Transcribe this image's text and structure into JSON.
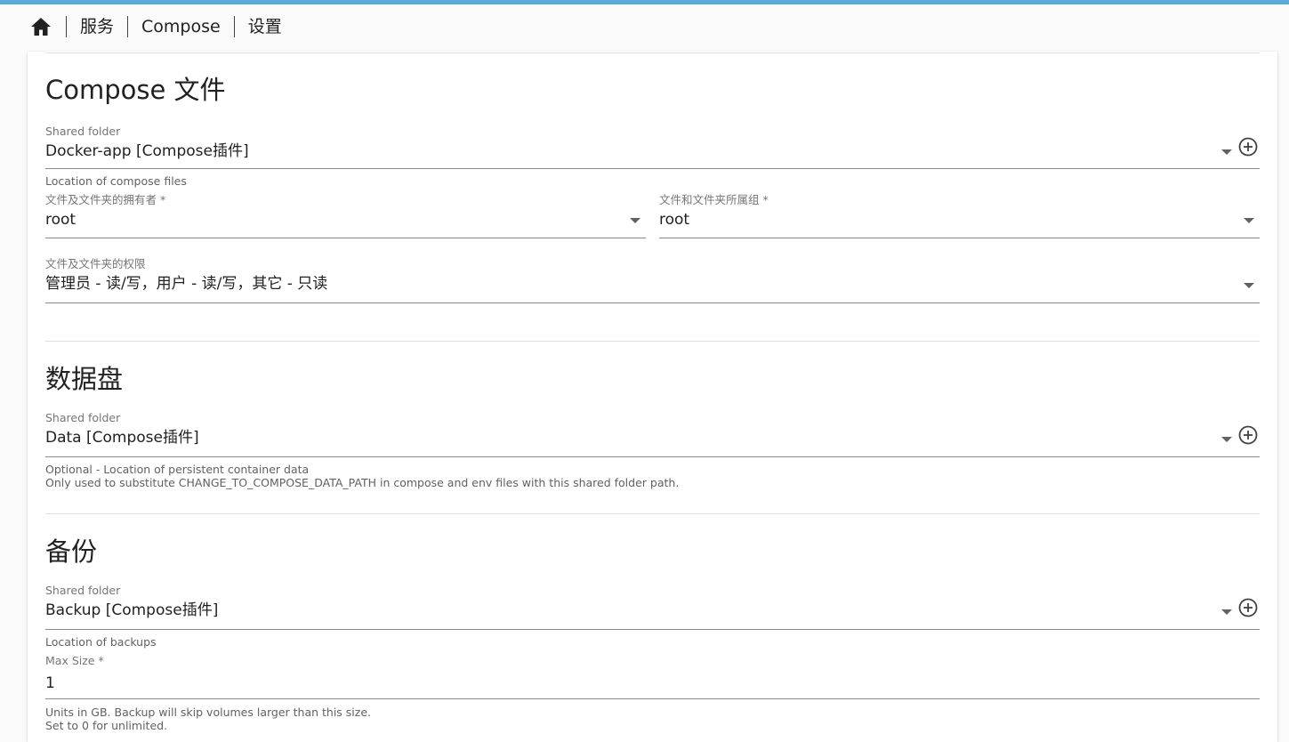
{
  "breadcrumb": {
    "items": [
      "服务",
      "Compose",
      "设置"
    ]
  },
  "sections": {
    "compose": {
      "title": "Compose 文件",
      "shared_folder": {
        "label": "Shared folder",
        "value": "Docker-app [Compose插件]",
        "hint": "Location of compose files"
      },
      "owner": {
        "label": "文件及文件夹的拥有者 *",
        "value": "root"
      },
      "group": {
        "label": "文件和文件夹所属组 *",
        "value": "root"
      },
      "permissions": {
        "label": "文件及文件夹的权限",
        "value": "管理员 - 读/写，用户 - 读/写，其它 - 只读"
      }
    },
    "data": {
      "title": "数据盘",
      "shared_folder": {
        "label": "Shared folder",
        "value": "Data [Compose插件]",
        "hint_line1": "Optional - Location of persistent container data",
        "hint_line2": "Only used to substitute CHANGE_TO_COMPOSE_DATA_PATH in compose and env files with this shared folder path."
      }
    },
    "backup": {
      "title": "备份",
      "shared_folder": {
        "label": "Shared folder",
        "value": "Backup [Compose插件]",
        "hint": "Location of backups"
      },
      "max_size": {
        "label": "Max Size *",
        "value": "1",
        "hint_line1": "Units in GB. Backup will skip volumes larger than this size.",
        "hint_line2": "Set to 0 for unlimited."
      }
    }
  },
  "icons": {
    "home": "home-icon",
    "dropdown": "arrow-drop-down-icon",
    "add": "add-circle-outline-icon"
  },
  "colors": {
    "accent": "#5aa9dd",
    "text": "#212121",
    "label": "#757575"
  }
}
